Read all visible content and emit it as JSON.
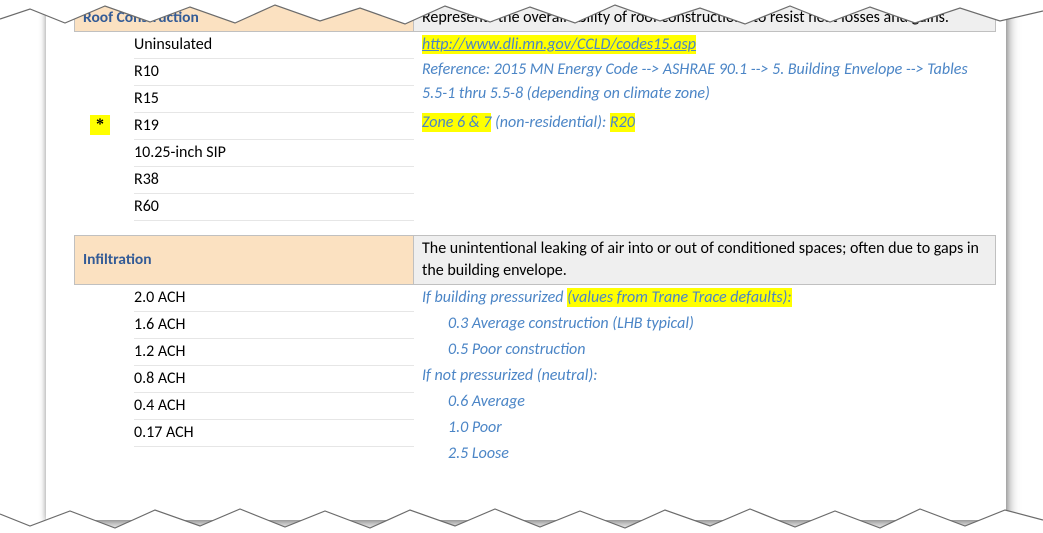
{
  "roof": {
    "title": "Roof Construction",
    "description": "Represents the overall ability of roof constructions to resist heat losses and gains.",
    "options": [
      "Uninsulated",
      "R10",
      "R15",
      "R19",
      "10.25-inch SIP",
      "R38",
      "R60"
    ],
    "selected_index": 3,
    "star": "*",
    "notes": {
      "link": "http://www.dli.mn.gov/CCLD/codes15.asp",
      "reference": "Reference: 2015 MN Energy Code --> ASHRAE 90.1 --> 5. Building Envelope --> Tables 5.5-1 thru 5.5-8 (depending on climate zone)",
      "zone_prefix": "Zone 6 & 7",
      "zone_mid": " (non-residential): ",
      "zone_suffix": "R20"
    }
  },
  "infiltration": {
    "title": "Infiltration",
    "description": "The unintentional leaking of air into or out of conditioned spaces; often due to gaps in the building envelope.",
    "options": [
      "2.0 ACH",
      "1.6 ACH",
      "1.2 ACH",
      "0.8 ACH",
      "0.4 ACH",
      "0.17 ACH"
    ],
    "notes": {
      "line1_a": "If building pressurized ",
      "line1_b": "(values from Trane Trace defaults):",
      "line2": "0.3 Average construction (LHB typical)",
      "line3": "0.5 Poor construction",
      "line4": "If not pressurized (neutral):",
      "line5": "0.6 Average",
      "line6": "1.0 Poor",
      "line7": "2.5 Loose"
    }
  }
}
